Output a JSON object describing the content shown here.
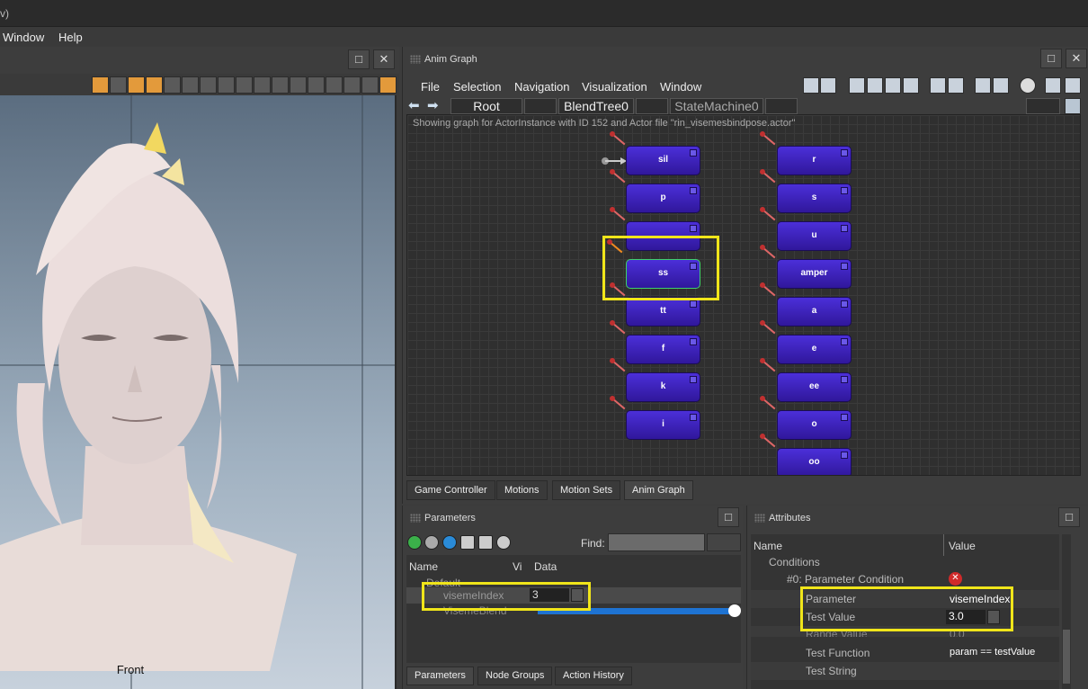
{
  "app": {
    "title_fragment": "v)",
    "menu": [
      "Window",
      "Help"
    ]
  },
  "viewport": {
    "label": "Front",
    "window_buttons": [
      "□",
      "✕"
    ]
  },
  "anim_graph": {
    "title": "Anim Graph",
    "menu": [
      "File",
      "Selection",
      "Navigation",
      "Visualization",
      "Window"
    ],
    "breadcrumb": [
      "Root",
      "BlendTree0",
      "StateMachine0"
    ],
    "info": "Showing graph for ActorInstance with ID 152 and Actor file \"rin_visemesbindpose.actor\"",
    "nodes_left": [
      "sil",
      "p",
      "",
      "ss",
      "tt",
      "f",
      "k",
      "i"
    ],
    "nodes_right": [
      "r",
      "s",
      "u",
      "amper",
      "a",
      "e",
      "ee",
      "o",
      "oo"
    ],
    "selected_node": "ss",
    "tabs": [
      "Game Controller",
      "Motions",
      "Motion Sets",
      "Anim Graph"
    ],
    "active_tab": "Anim Graph"
  },
  "parameters": {
    "title": "Parameters",
    "find_label": "Find:",
    "find_value": "",
    "columns": [
      "Name",
      "Vi",
      "Data"
    ],
    "group": "Default",
    "rows": [
      {
        "name": "visemeIndex",
        "value": "3"
      },
      {
        "name": "VisemeBlend",
        "value": ""
      }
    ],
    "blend_fill": 1.0,
    "tabs": [
      "Parameters",
      "Node Groups",
      "Action History"
    ],
    "active_tab": "Parameters"
  },
  "attributes": {
    "title": "Attributes",
    "columns": [
      "Name",
      "Value"
    ],
    "section": "Conditions",
    "condition": "#0: Parameter Condition",
    "rows": [
      {
        "name": "Parameter",
        "value": "visemeIndex"
      },
      {
        "name": "Test Value",
        "value": "3.0"
      },
      {
        "name": "Range Value",
        "value": "0.0"
      },
      {
        "name": "Test Function",
        "value": "param == testValue"
      },
      {
        "name": "Test String",
        "value": ""
      }
    ]
  },
  "colors": {
    "node_fill": "#3a20c4",
    "highlight": "#f0e51a",
    "selected_outline": "#3fcf6c",
    "blend_bar": "#1e73d2"
  }
}
